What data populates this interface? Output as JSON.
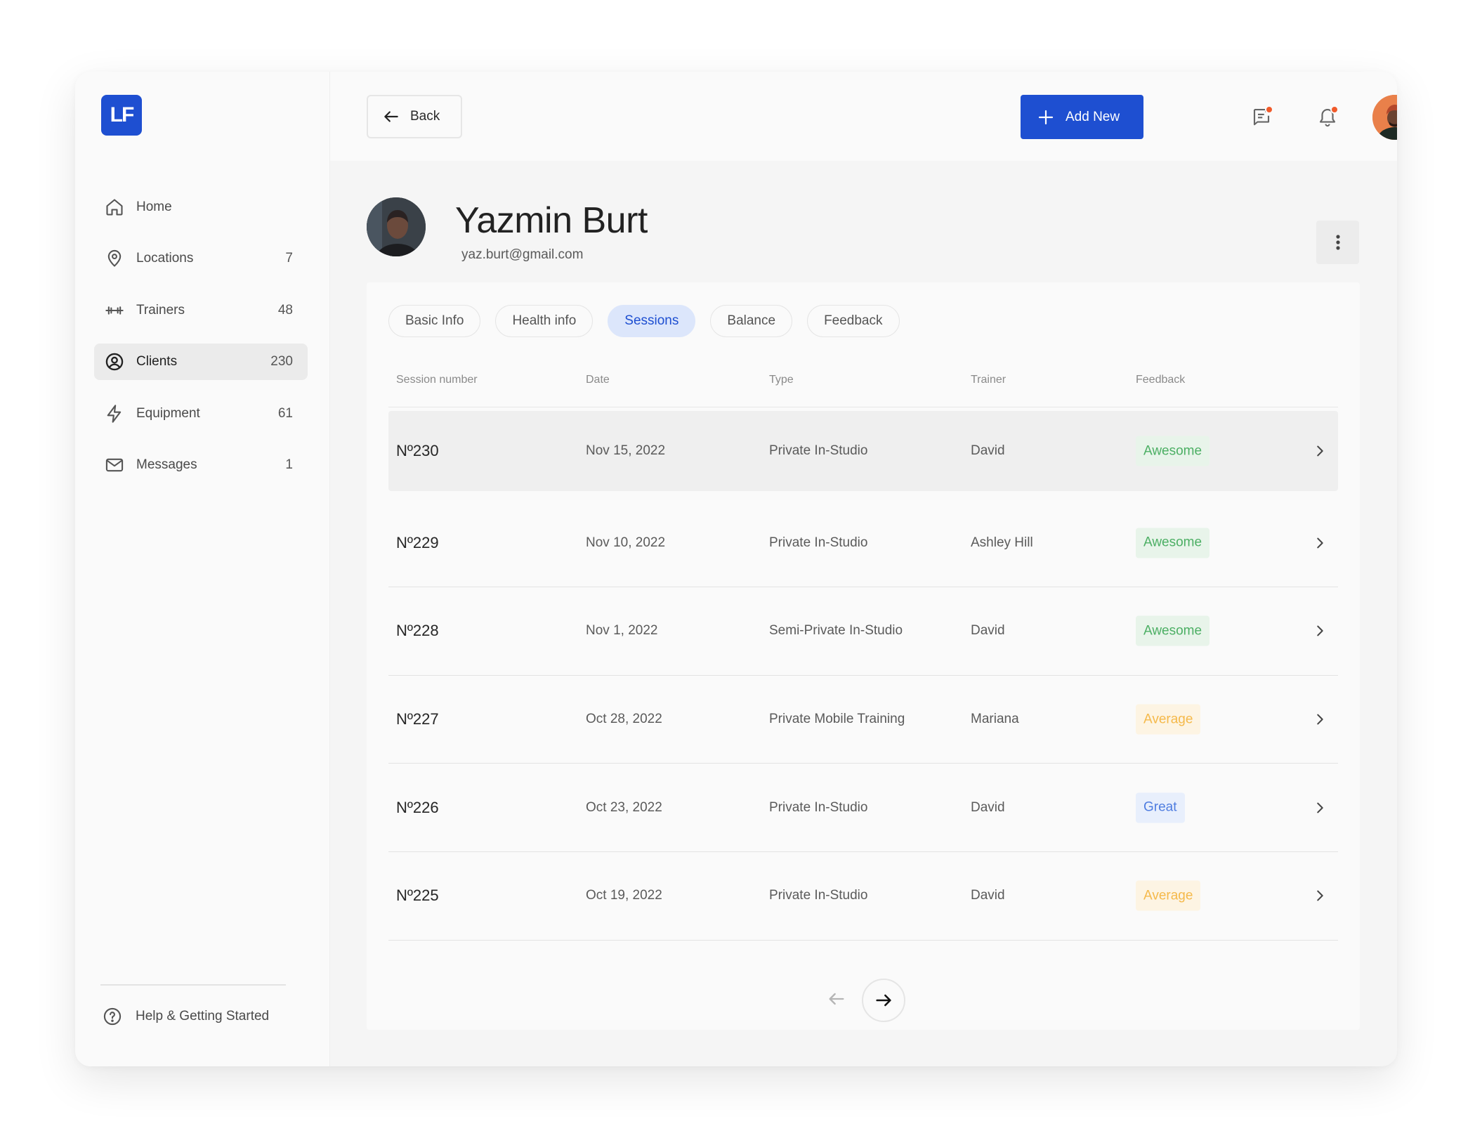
{
  "app": {
    "logo_text": "LF",
    "brand_color": "#1e4fd1"
  },
  "sidebar": {
    "items": [
      {
        "label": "Home",
        "count": "",
        "icon": "home-icon"
      },
      {
        "label": "Locations",
        "count": "7",
        "icon": "location-pin-icon"
      },
      {
        "label": "Trainers",
        "count": "48",
        "icon": "dumbbell-icon"
      },
      {
        "label": "Clients",
        "count": "230",
        "icon": "user-circle-icon",
        "active": true
      },
      {
        "label": "Equipment",
        "count": "61",
        "icon": "lightning-icon"
      },
      {
        "label": "Messages",
        "count": "1",
        "icon": "mail-icon"
      }
    ],
    "help_label": "Help & Getting Started"
  },
  "topbar": {
    "back_label": "Back",
    "add_new_label": "Add New",
    "notification_dot_color": "#f05a2a"
  },
  "profile": {
    "name": "Yazmin Burt",
    "email": "yaz.burt@gmail.com"
  },
  "tabs": [
    {
      "label": "Basic Info"
    },
    {
      "label": "Health info"
    },
    {
      "label": "Sessions",
      "active": true
    },
    {
      "label": "Balance"
    },
    {
      "label": "Feedback"
    }
  ],
  "table": {
    "columns": [
      "Session number",
      "Date",
      "Type",
      "Trainer",
      "Feedback"
    ],
    "rows": [
      {
        "number": "Nº230",
        "date": "Nov 15, 2022",
        "type": "Private In-Studio",
        "trainer": "David",
        "feedback": "Awesome",
        "feedback_kind": "awesome"
      },
      {
        "number": "Nº229",
        "date": "Nov 10, 2022",
        "type": "Private In-Studio",
        "trainer": "Ashley Hill",
        "feedback": "Awesome",
        "feedback_kind": "awesome"
      },
      {
        "number": "Nº228",
        "date": "Nov 1, 2022",
        "type": "Semi-Private In-Studio",
        "trainer": "David",
        "feedback": "Awesome",
        "feedback_kind": "awesome"
      },
      {
        "number": "Nº227",
        "date": "Oct 28, 2022",
        "type": "Private Mobile Training",
        "trainer": "Mariana",
        "feedback": "Average",
        "feedback_kind": "average"
      },
      {
        "number": "Nº226",
        "date": "Oct 23, 2022",
        "type": "Private In-Studio",
        "trainer": "David",
        "feedback": "Great",
        "feedback_kind": "great"
      },
      {
        "number": "Nº225",
        "date": "Oct 19, 2022",
        "type": "Private In-Studio",
        "trainer": "David",
        "feedback": "Average",
        "feedback_kind": "average"
      }
    ]
  },
  "colors": {
    "awesome": "#4caf64",
    "average": "#f5b94a",
    "great": "#4f7de0"
  }
}
